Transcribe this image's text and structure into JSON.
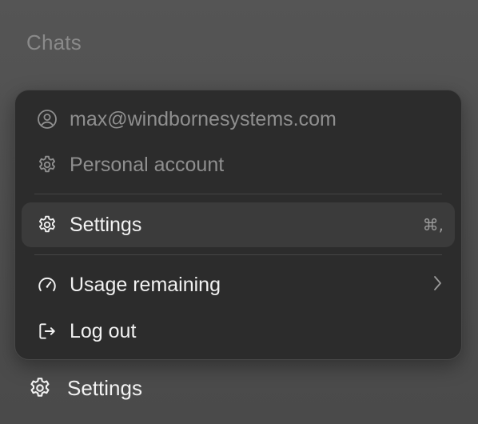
{
  "sidebar": {
    "heading": "Chats",
    "footer_settings_label": "Settings"
  },
  "menu": {
    "account_email": "max@windbornesystems.com",
    "account_type": "Personal account",
    "settings_label": "Settings",
    "settings_shortcut": "⌘,",
    "usage_label": "Usage remaining",
    "logout_label": "Log out"
  },
  "icons": {
    "account": "user-circle-icon",
    "account_type": "gear-icon",
    "settings": "gear-icon",
    "usage": "gauge-icon",
    "usage_chevron": "chevron-right-icon",
    "logout": "log-out-icon",
    "footer_settings": "gear-icon"
  },
  "colors": {
    "menu_background": "#2c2c2c",
    "highlight_background": "#3b3b3b",
    "muted_text": "#8f8f8f",
    "bright_text": "#f2f2f2"
  }
}
